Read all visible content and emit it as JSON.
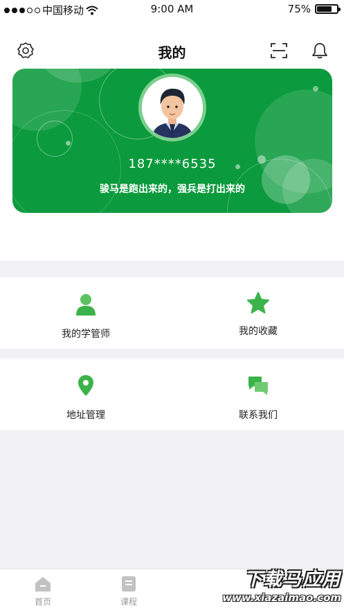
{
  "status_bar": {
    "carrier": "中国移动",
    "time": "9:00 AM",
    "battery": "75%",
    "battery_level": 0.75
  },
  "header": {
    "title": "我的"
  },
  "profile": {
    "phone": "187****6535",
    "motto": "骏马是跑出来的，强兵是打出来的"
  },
  "menu": [
    {
      "label": "我的学管师",
      "icon": "person-icon"
    },
    {
      "label": "我的收藏",
      "icon": "star-icon"
    },
    {
      "label": "地址管理",
      "icon": "location-pin-icon"
    },
    {
      "label": "联系我们",
      "icon": "chat-bubbles-icon"
    }
  ],
  "tabbar": {
    "items": [
      {
        "label": "首页",
        "icon": "home-icon"
      },
      {
        "label": "课程",
        "icon": "course-icon"
      }
    ]
  },
  "watermark": {
    "line1": "下载马应用",
    "line2": "www.xiazaimao.com"
  },
  "colors": {
    "brand_green": "#0b9a3d",
    "icon_green": "#3cb34a"
  }
}
